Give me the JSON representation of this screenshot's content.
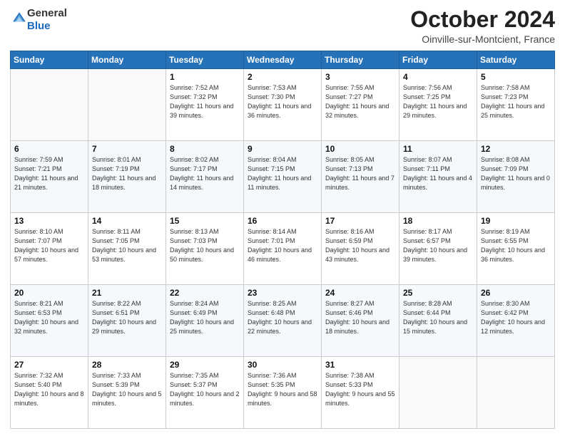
{
  "header": {
    "logo": {
      "line1": "General",
      "line2": "Blue"
    },
    "title": "October 2024",
    "location": "Oinville-sur-Montcient, France"
  },
  "days_of_week": [
    "Sunday",
    "Monday",
    "Tuesday",
    "Wednesday",
    "Thursday",
    "Friday",
    "Saturday"
  ],
  "weeks": [
    [
      {
        "num": "",
        "sunrise": "",
        "sunset": "",
        "daylight": ""
      },
      {
        "num": "",
        "sunrise": "",
        "sunset": "",
        "daylight": ""
      },
      {
        "num": "1",
        "sunrise": "Sunrise: 7:52 AM",
        "sunset": "Sunset: 7:32 PM",
        "daylight": "Daylight: 11 hours and 39 minutes."
      },
      {
        "num": "2",
        "sunrise": "Sunrise: 7:53 AM",
        "sunset": "Sunset: 7:30 PM",
        "daylight": "Daylight: 11 hours and 36 minutes."
      },
      {
        "num": "3",
        "sunrise": "Sunrise: 7:55 AM",
        "sunset": "Sunset: 7:27 PM",
        "daylight": "Daylight: 11 hours and 32 minutes."
      },
      {
        "num": "4",
        "sunrise": "Sunrise: 7:56 AM",
        "sunset": "Sunset: 7:25 PM",
        "daylight": "Daylight: 11 hours and 29 minutes."
      },
      {
        "num": "5",
        "sunrise": "Sunrise: 7:58 AM",
        "sunset": "Sunset: 7:23 PM",
        "daylight": "Daylight: 11 hours and 25 minutes."
      }
    ],
    [
      {
        "num": "6",
        "sunrise": "Sunrise: 7:59 AM",
        "sunset": "Sunset: 7:21 PM",
        "daylight": "Daylight: 11 hours and 21 minutes."
      },
      {
        "num": "7",
        "sunrise": "Sunrise: 8:01 AM",
        "sunset": "Sunset: 7:19 PM",
        "daylight": "Daylight: 11 hours and 18 minutes."
      },
      {
        "num": "8",
        "sunrise": "Sunrise: 8:02 AM",
        "sunset": "Sunset: 7:17 PM",
        "daylight": "Daylight: 11 hours and 14 minutes."
      },
      {
        "num": "9",
        "sunrise": "Sunrise: 8:04 AM",
        "sunset": "Sunset: 7:15 PM",
        "daylight": "Daylight: 11 hours and 11 minutes."
      },
      {
        "num": "10",
        "sunrise": "Sunrise: 8:05 AM",
        "sunset": "Sunset: 7:13 PM",
        "daylight": "Daylight: 11 hours and 7 minutes."
      },
      {
        "num": "11",
        "sunrise": "Sunrise: 8:07 AM",
        "sunset": "Sunset: 7:11 PM",
        "daylight": "Daylight: 11 hours and 4 minutes."
      },
      {
        "num": "12",
        "sunrise": "Sunrise: 8:08 AM",
        "sunset": "Sunset: 7:09 PM",
        "daylight": "Daylight: 11 hours and 0 minutes."
      }
    ],
    [
      {
        "num": "13",
        "sunrise": "Sunrise: 8:10 AM",
        "sunset": "Sunset: 7:07 PM",
        "daylight": "Daylight: 10 hours and 57 minutes."
      },
      {
        "num": "14",
        "sunrise": "Sunrise: 8:11 AM",
        "sunset": "Sunset: 7:05 PM",
        "daylight": "Daylight: 10 hours and 53 minutes."
      },
      {
        "num": "15",
        "sunrise": "Sunrise: 8:13 AM",
        "sunset": "Sunset: 7:03 PM",
        "daylight": "Daylight: 10 hours and 50 minutes."
      },
      {
        "num": "16",
        "sunrise": "Sunrise: 8:14 AM",
        "sunset": "Sunset: 7:01 PM",
        "daylight": "Daylight: 10 hours and 46 minutes."
      },
      {
        "num": "17",
        "sunrise": "Sunrise: 8:16 AM",
        "sunset": "Sunset: 6:59 PM",
        "daylight": "Daylight: 10 hours and 43 minutes."
      },
      {
        "num": "18",
        "sunrise": "Sunrise: 8:17 AM",
        "sunset": "Sunset: 6:57 PM",
        "daylight": "Daylight: 10 hours and 39 minutes."
      },
      {
        "num": "19",
        "sunrise": "Sunrise: 8:19 AM",
        "sunset": "Sunset: 6:55 PM",
        "daylight": "Daylight: 10 hours and 36 minutes."
      }
    ],
    [
      {
        "num": "20",
        "sunrise": "Sunrise: 8:21 AM",
        "sunset": "Sunset: 6:53 PM",
        "daylight": "Daylight: 10 hours and 32 minutes."
      },
      {
        "num": "21",
        "sunrise": "Sunrise: 8:22 AM",
        "sunset": "Sunset: 6:51 PM",
        "daylight": "Daylight: 10 hours and 29 minutes."
      },
      {
        "num": "22",
        "sunrise": "Sunrise: 8:24 AM",
        "sunset": "Sunset: 6:49 PM",
        "daylight": "Daylight: 10 hours and 25 minutes."
      },
      {
        "num": "23",
        "sunrise": "Sunrise: 8:25 AM",
        "sunset": "Sunset: 6:48 PM",
        "daylight": "Daylight: 10 hours and 22 minutes."
      },
      {
        "num": "24",
        "sunrise": "Sunrise: 8:27 AM",
        "sunset": "Sunset: 6:46 PM",
        "daylight": "Daylight: 10 hours and 18 minutes."
      },
      {
        "num": "25",
        "sunrise": "Sunrise: 8:28 AM",
        "sunset": "Sunset: 6:44 PM",
        "daylight": "Daylight: 10 hours and 15 minutes."
      },
      {
        "num": "26",
        "sunrise": "Sunrise: 8:30 AM",
        "sunset": "Sunset: 6:42 PM",
        "daylight": "Daylight: 10 hours and 12 minutes."
      }
    ],
    [
      {
        "num": "27",
        "sunrise": "Sunrise: 7:32 AM",
        "sunset": "Sunset: 5:40 PM",
        "daylight": "Daylight: 10 hours and 8 minutes."
      },
      {
        "num": "28",
        "sunrise": "Sunrise: 7:33 AM",
        "sunset": "Sunset: 5:39 PM",
        "daylight": "Daylight: 10 hours and 5 minutes."
      },
      {
        "num": "29",
        "sunrise": "Sunrise: 7:35 AM",
        "sunset": "Sunset: 5:37 PM",
        "daylight": "Daylight: 10 hours and 2 minutes."
      },
      {
        "num": "30",
        "sunrise": "Sunrise: 7:36 AM",
        "sunset": "Sunset: 5:35 PM",
        "daylight": "Daylight: 9 hours and 58 minutes."
      },
      {
        "num": "31",
        "sunrise": "Sunrise: 7:38 AM",
        "sunset": "Sunset: 5:33 PM",
        "daylight": "Daylight: 9 hours and 55 minutes."
      },
      {
        "num": "",
        "sunrise": "",
        "sunset": "",
        "daylight": ""
      },
      {
        "num": "",
        "sunrise": "",
        "sunset": "",
        "daylight": ""
      }
    ]
  ]
}
